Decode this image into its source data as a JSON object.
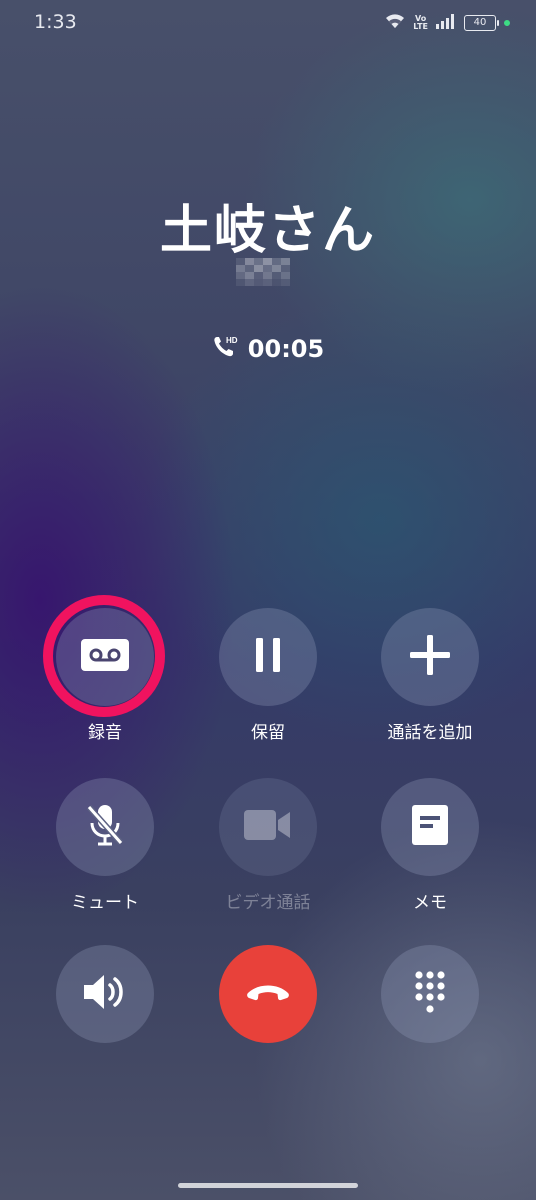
{
  "status_bar": {
    "time": "1:33",
    "network_label_top": "Vo",
    "network_label_bottom": "LTE",
    "battery": "40"
  },
  "call": {
    "caller_name": "土岐さん",
    "hd_badge": "HD",
    "duration": "00:05"
  },
  "controls": {
    "record": {
      "label": "録音",
      "icon": "voicemail-icon",
      "highlighted": true
    },
    "hold": {
      "label": "保留",
      "icon": "pause-icon"
    },
    "add_call": {
      "label": "通話を追加",
      "icon": "plus-icon"
    },
    "mute": {
      "label": "ミュート",
      "icon": "mic-off-icon"
    },
    "video_call": {
      "label": "ビデオ通話",
      "icon": "video-camera-icon",
      "disabled": true
    },
    "memo": {
      "label": "メモ",
      "icon": "note-icon"
    },
    "speaker": {
      "icon": "speaker-icon"
    },
    "end_call": {
      "icon": "hang-up-icon",
      "color": "#e8413a"
    },
    "keypad": {
      "icon": "dialpad-icon"
    }
  },
  "colors": {
    "record_ring": "#f0135f",
    "end_call": "#e8413a"
  }
}
